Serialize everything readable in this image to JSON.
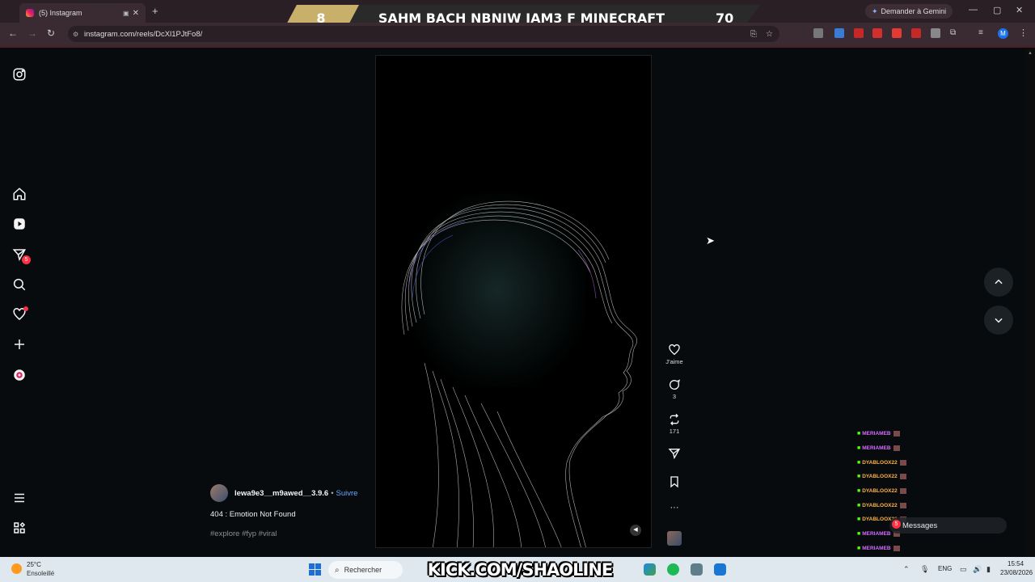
{
  "browser": {
    "tab_title": "(5) Instagram",
    "new_tab": "+",
    "url": "instagram.com/reels/DcXl1PJtFo8/",
    "gemini": "Demander à Gemini",
    "profile_initial": "M",
    "window_controls": {
      "minimize": "—",
      "maximize": "▢",
      "close": "✕"
    },
    "nav": {
      "back": "←",
      "forward": "→",
      "reload": "↻"
    }
  },
  "stream_banner": {
    "left_score": "8",
    "title": "SAHM BACH NBNIW JAM3 F MINECRAFT",
    "right_score": "70"
  },
  "sidebar": {
    "icons": [
      "instagram-logo-icon",
      "home-icon",
      "reels-icon",
      "messages-icon",
      "search-icon",
      "notifications-icon",
      "create-icon",
      "threads-icon",
      "menu-icon",
      "more-apps-icon"
    ],
    "messages_badge": "5"
  },
  "reel": {
    "author": "lewa9e3__m9awed__3.9.6",
    "separator": "•",
    "follow": "Suivre",
    "caption": "404 : Emotion Not Found",
    "hashtags": "#explore #fyp #viral",
    "like_label": "J'aime",
    "comments_count": "3",
    "reposts_count": "171",
    "more": "···"
  },
  "chat": [
    {
      "user": "MERIAMEB",
      "color": "#d66bff"
    },
    {
      "user": "MERIAMEB",
      "color": "#d66bff"
    },
    {
      "user": "DYABLOOX22",
      "color": "#ffb347"
    },
    {
      "user": "DYABLOOX22",
      "color": "#ffb347"
    },
    {
      "user": "DYABLOOX22",
      "color": "#ffb347"
    },
    {
      "user": "DYABLOOX22",
      "color": "#ffb347"
    },
    {
      "user": "DYABLOOX22",
      "color": "#ffb347"
    },
    {
      "user": "MERIAMEB",
      "color": "#d66bff"
    },
    {
      "user": "MERIAMEB",
      "color": "#d66bff"
    }
  ],
  "messages_popup": {
    "label": "Messages",
    "badge": "5"
  },
  "taskbar": {
    "temp": "25°C",
    "weather": "Ensoleillé",
    "search": "Rechercher",
    "kick_prefix": "K",
    "kick_text": "KICK.COM/SHAOLINE",
    "lang": "ENG",
    "time": "15:54",
    "date": "23/08/2026"
  }
}
